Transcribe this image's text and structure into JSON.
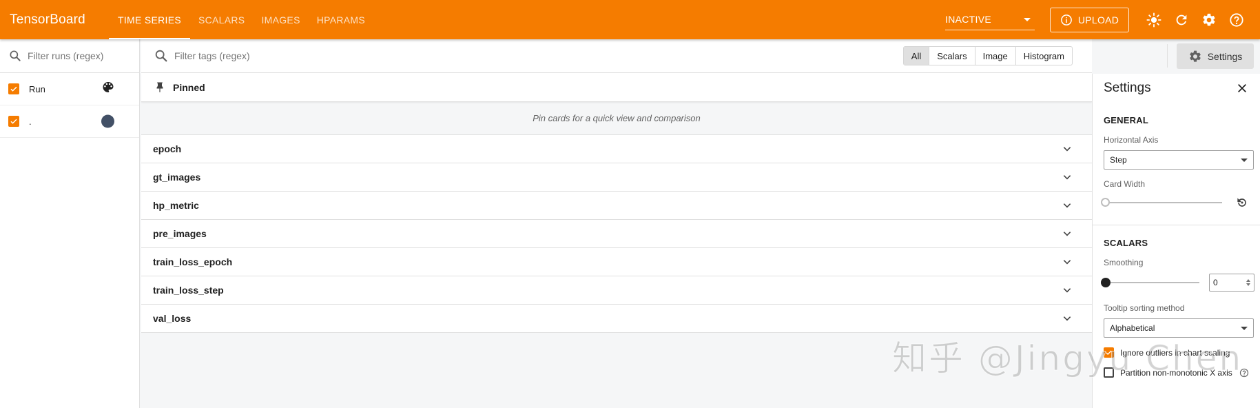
{
  "app": {
    "title": "TensorBoard"
  },
  "nav": {
    "tabs": [
      {
        "label": "TIME SERIES",
        "active": true
      },
      {
        "label": "SCALARS"
      },
      {
        "label": "IMAGES"
      },
      {
        "label": "HPARAMS"
      }
    ]
  },
  "topbar": {
    "run_state": "INACTIVE",
    "upload_label": "UPLOAD",
    "icons": [
      "brightness-icon",
      "refresh-icon",
      "settings-gear-icon",
      "help-icon"
    ]
  },
  "runs": {
    "filter_placeholder": "Filter runs (regex)",
    "header_label": "Run",
    "items": [
      {
        "label": ".",
        "color": "#425066",
        "checked": true
      }
    ]
  },
  "main": {
    "tag_filter_placeholder": "Filter tags (regex)",
    "type_filters": [
      "All",
      "Scalars",
      "Image",
      "Histogram"
    ],
    "active_type_filter": "All",
    "settings_button": "Settings",
    "pinned": {
      "title": "Pinned",
      "empty_text": "Pin cards for a quick view and comparison"
    },
    "groups": [
      "epoch",
      "gt_images",
      "hp_metric",
      "pre_images",
      "train_loss_epoch",
      "train_loss_step",
      "val_loss"
    ]
  },
  "settings": {
    "title": "Settings",
    "general": {
      "section": "GENERAL",
      "horizontal_axis_label": "Horizontal Axis",
      "horizontal_axis_value": "Step",
      "card_width_label": "Card Width"
    },
    "scalars": {
      "section": "SCALARS",
      "smoothing_label": "Smoothing",
      "smoothing_value": "0",
      "tooltip_label": "Tooltip sorting method",
      "tooltip_value": "Alphabetical",
      "ignore_outliers_label": "Ignore outliers in chart scaling",
      "ignore_outliers_checked": true,
      "partition_label": "Partition non-monotonic X axis",
      "partition_checked": false
    }
  },
  "watermark": "知乎 @Jingyu Chen",
  "colors": {
    "accent": "#f57c00",
    "run_dot": "#425066"
  }
}
